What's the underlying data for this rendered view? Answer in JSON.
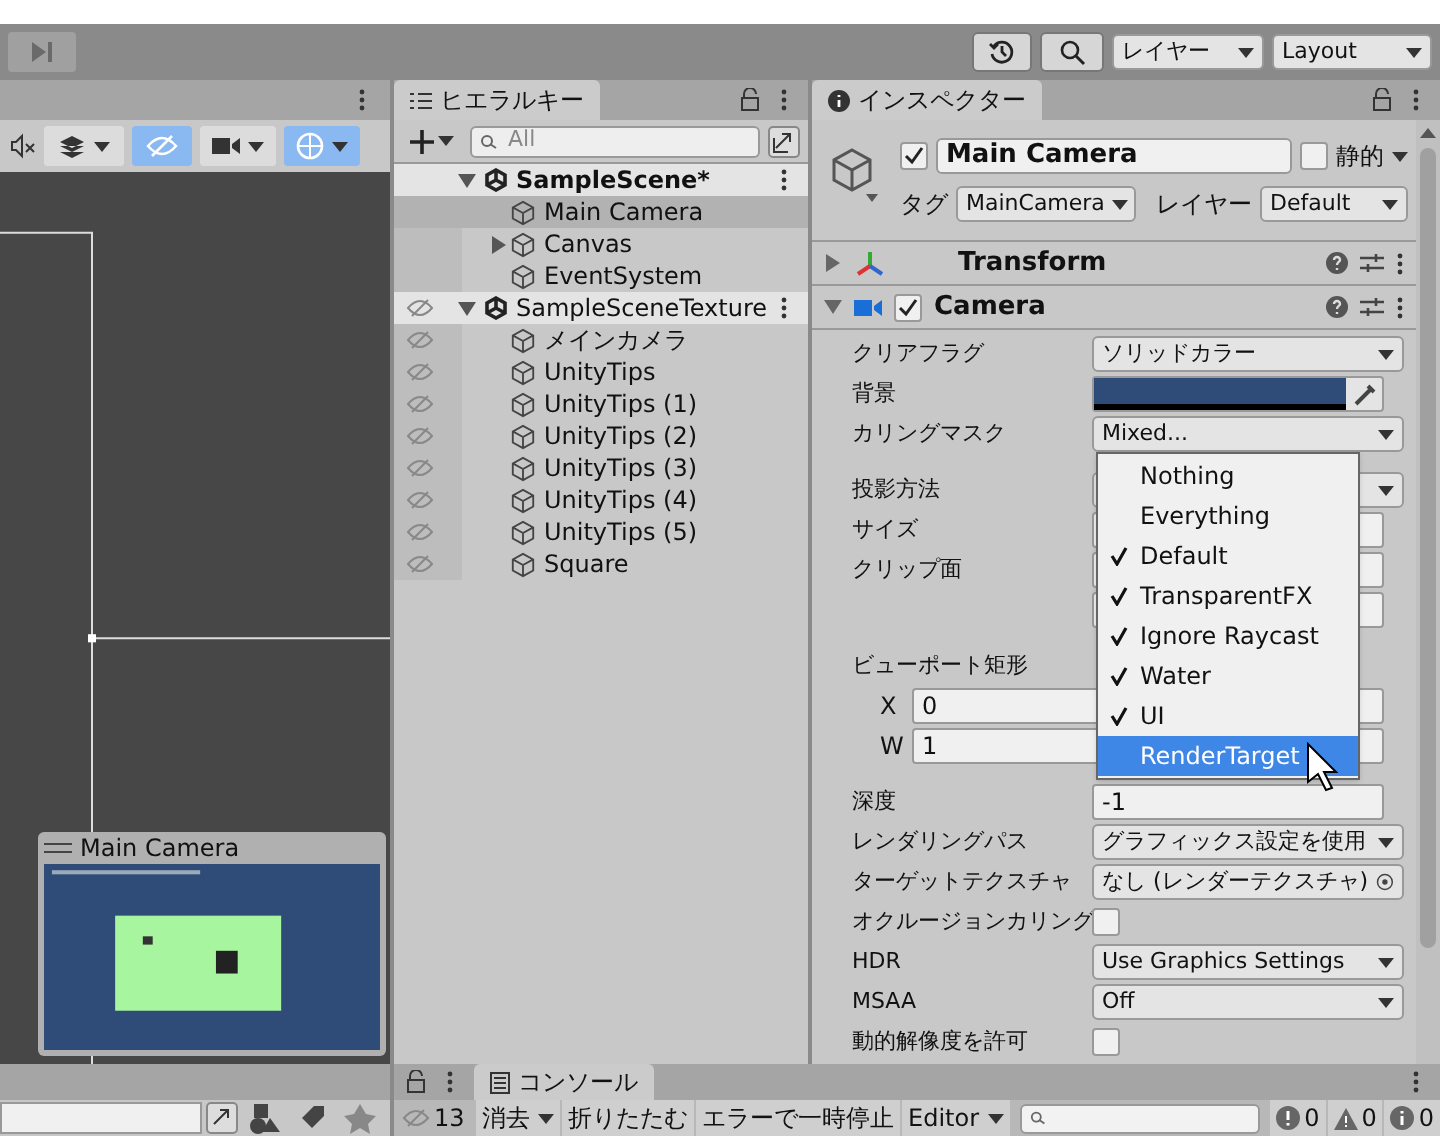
{
  "toolbar": {
    "layers": "レイヤー",
    "layout": "Layout"
  },
  "scene_view": {
    "preview_title": "Main Camera"
  },
  "hierarchy": {
    "tab": "ヒエラルキー",
    "search_placeholder": "All",
    "scenes": [
      {
        "name": "SampleScene*",
        "bold": true,
        "hidden": false,
        "expanded": true,
        "children": [
          {
            "name": "Main Camera",
            "selected": true,
            "expandable": false
          },
          {
            "name": "Canvas",
            "selected": false,
            "expandable": true
          },
          {
            "name": "EventSystem",
            "selected": false,
            "expandable": false
          }
        ]
      },
      {
        "name": "SampleSceneTexture",
        "bold": false,
        "hidden": true,
        "expanded": true,
        "children": [
          {
            "name": "メインカメラ",
            "selected": false,
            "expandable": false
          },
          {
            "name": "UnityTips",
            "selected": false,
            "expandable": false
          },
          {
            "name": "UnityTips (1)",
            "selected": false,
            "expandable": false
          },
          {
            "name": "UnityTips (2)",
            "selected": false,
            "expandable": false
          },
          {
            "name": "UnityTips (3)",
            "selected": false,
            "expandable": false
          },
          {
            "name": "UnityTips (4)",
            "selected": false,
            "expandable": false
          },
          {
            "name": "UnityTips (5)",
            "selected": false,
            "expandable": false
          },
          {
            "name": "Square",
            "selected": false,
            "expandable": false
          }
        ]
      }
    ]
  },
  "inspector": {
    "tab": "インスペクター",
    "active": true,
    "name": "Main Camera",
    "static": false,
    "static_label": "静的",
    "tag_label": "タグ",
    "tag": "MainCamera",
    "layer_label": "レイヤー",
    "layer": "Default",
    "components": [
      {
        "name": "Transform",
        "expanded": false
      },
      {
        "name": "Camera",
        "expanded": true,
        "enabled": true
      }
    ],
    "properties": [
      {
        "kind": "dropdown",
        "label": "クリアフラグ",
        "value": "ソリッドカラー"
      },
      {
        "kind": "color",
        "label": "背景",
        "color": "#2f4b77"
      },
      {
        "kind": "dropdown",
        "label": "カリングマスク",
        "value": "Mixed..."
      },
      {
        "kind": "gap"
      },
      {
        "kind": "dropdown",
        "label": "投影方法"
      },
      {
        "kind": "field",
        "label": "サイズ"
      },
      {
        "kind": "field",
        "label": "クリップ面"
      },
      {
        "kind": "field"
      },
      {
        "kind": "gap"
      },
      {
        "kind": "label",
        "label": "ビューポート矩形"
      },
      {
        "kind": "field",
        "sub": "X",
        "value": "0"
      },
      {
        "kind": "field",
        "sub": "W",
        "value": "1"
      },
      {
        "kind": "gap"
      },
      {
        "kind": "field",
        "label": "深度",
        "value": "-1"
      },
      {
        "kind": "dropdown",
        "label": "レンダリングパス",
        "value": "グラフィックス設定を使用"
      },
      {
        "kind": "object",
        "label": "ターゲットテクスチャ",
        "value": "なし (レンダーテクスチャ)"
      },
      {
        "kind": "checkbox",
        "label": "オクルージョンカリング",
        "checked": false
      },
      {
        "kind": "dropdown",
        "label": "HDR",
        "value": "Use Graphics Settings"
      },
      {
        "kind": "dropdown",
        "label": "MSAA",
        "value": "Off"
      },
      {
        "kind": "checkbox",
        "label": "動的解像度を許可",
        "checked": false
      }
    ]
  },
  "mask_menu": [
    {
      "label": "Nothing",
      "checked": false,
      "selected": false
    },
    {
      "label": "Everything",
      "checked": false,
      "selected": false
    },
    {
      "label": "Default",
      "checked": true,
      "selected": false
    },
    {
      "label": "TransparentFX",
      "checked": true,
      "selected": false
    },
    {
      "label": "Ignore Raycast",
      "checked": true,
      "selected": false
    },
    {
      "label": "Water",
      "checked": true,
      "selected": false
    },
    {
      "label": "UI",
      "checked": true,
      "selected": false
    },
    {
      "label": "RenderTarget",
      "checked": false,
      "selected": true
    }
  ],
  "console": {
    "tab": "コンソール",
    "hidden_count": "13",
    "buttons": [
      "消去",
      "折りたたむ",
      "エラーで一時停止",
      "Editor"
    ],
    "counts": [
      {
        "kind": "error",
        "value": "0"
      },
      {
        "kind": "warning",
        "value": "0"
      },
      {
        "kind": "info",
        "value": "0"
      }
    ]
  }
}
